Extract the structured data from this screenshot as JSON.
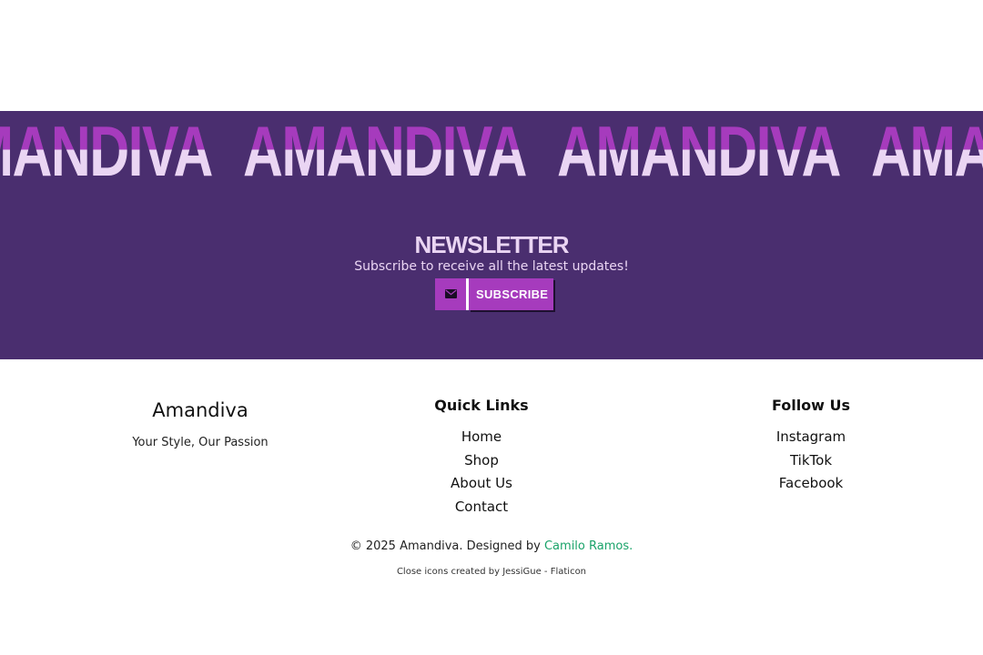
{
  "marquee": {
    "words": [
      "AMANDIVA",
      "AMANDIVA",
      "AMANDIVA",
      "AMANDIVA"
    ]
  },
  "newsletter": {
    "title": "NEWSLETTER",
    "subtitle": "Subscribe to receive all the latest updates!",
    "mail_icon": "envelope-icon",
    "subscribe_label": "SUBSCRIBE"
  },
  "footer": {
    "brand": {
      "name": "Amandiva",
      "tagline": "Your Style, Our Passion"
    },
    "quick_links": {
      "title": "Quick Links",
      "items": [
        "Home",
        "Shop",
        "About Us",
        "Contact"
      ]
    },
    "follow": {
      "title": "Follow Us",
      "items": [
        "Instagram",
        "TikTok",
        "Facebook"
      ]
    },
    "copyright": {
      "prefix": "© 2025 Amandiva. Designed by ",
      "designer": "Camilo Ramos",
      "suffix": "."
    },
    "attribution": "Close icons created by JessiGue - Flaticon"
  },
  "colors": {
    "band_bg": "#4a2e6f",
    "accent": "#a63bbd",
    "light_text": "#ead5f3",
    "link_green": "#1aa36a"
  }
}
